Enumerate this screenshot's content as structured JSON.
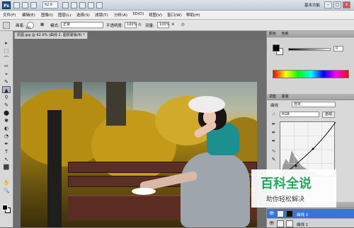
{
  "app": {
    "logo": "Ps",
    "zoom": "62.6",
    "workspace": "基本功能",
    "window_controls": [
      "-",
      "□",
      "x"
    ]
  },
  "menu": [
    "文件(F)",
    "编辑(E)",
    "图像(I)",
    "图层(L)",
    "选择(S)",
    "滤镜(T)",
    "分析(A)",
    "3D(D)",
    "视图(V)",
    "窗口(W)",
    "帮助(H)"
  ],
  "options": {
    "brush_label": "画笔:",
    "brush_size": "101",
    "mode_label": "模式:",
    "mode_value": "正常",
    "opacity_label": "不透明度:",
    "opacity_value": "100%",
    "flow_label": "流量:",
    "flow_value": "100%"
  },
  "document": {
    "tab_title": "原图.jpg @ 62.6% (曲线 2, 图层蒙版/8) *"
  },
  "panels": {
    "color_tab": "颜色",
    "swatch_tab": "色板",
    "color_value": "0",
    "adjust_tab": "调整",
    "mask_tab": "蒙版",
    "curves_label": "曲线",
    "preset_value": "自定",
    "channel_value": "RGB",
    "auto_label": "自动",
    "layers_tab": "图层",
    "layer_rows": [
      {
        "name": "曲线 2"
      },
      {
        "name": "曲线 1"
      }
    ]
  },
  "watermark": {
    "title": "百科全说",
    "subtitle": "助你轻松解决"
  },
  "tools": [
    "▸",
    "⬚",
    "⌒",
    "✂",
    "⌖",
    "✎",
    "▲",
    "⚲",
    "✎",
    "⬤",
    "✱",
    "◐",
    "◔",
    "✒",
    "T",
    "↖",
    "⬛",
    "✋",
    "🔍"
  ]
}
